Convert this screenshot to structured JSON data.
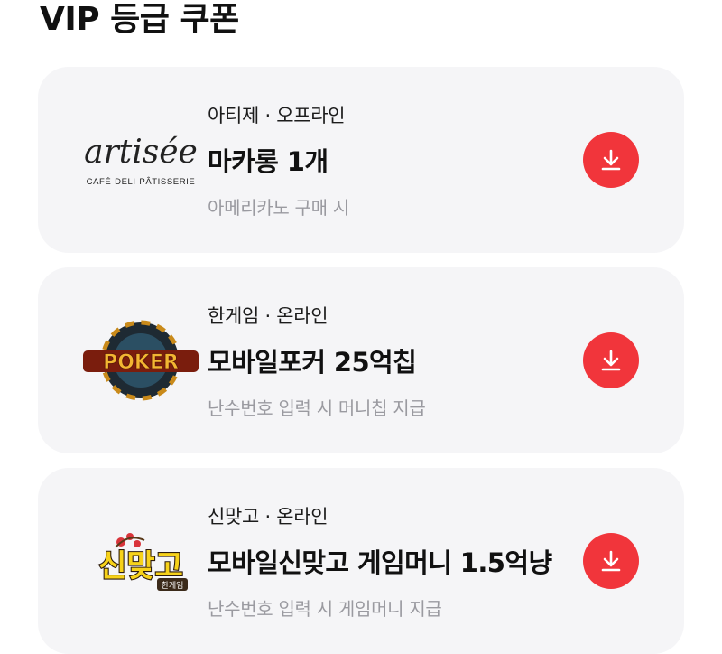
{
  "page": {
    "title": "VIP 등급 쿠폰"
  },
  "coupons": [
    {
      "brand": "아티제",
      "channel": "오프라인",
      "separator": "·",
      "title": "마카롱 1개",
      "condition": "아메리카노 구매 시",
      "logo": {
        "icon": "artisee-logo",
        "wordmark": "artisée",
        "tagline": "CAFÉ·DELI·PÂTISSERIE"
      }
    },
    {
      "brand": "한게임",
      "channel": "온라인",
      "separator": "·",
      "title": "모바일포커 25억칩",
      "condition": "난수번호 입력 시 머니칩 지급",
      "logo": {
        "icon": "poker-logo",
        "wordmark": "POKER"
      }
    },
    {
      "brand": "신맞고",
      "channel": "온라인",
      "separator": "·",
      "title": "모바일신맞고 게임머니 1.5억냥",
      "condition": "난수번호 입력 시 게임머니 지급",
      "logo": {
        "icon": "sinmatgo-logo",
        "wordmark": "신맞고",
        "sub": "한게임"
      }
    }
  ],
  "download_button": {
    "icon": "download-icon",
    "color": "#f1353b"
  }
}
